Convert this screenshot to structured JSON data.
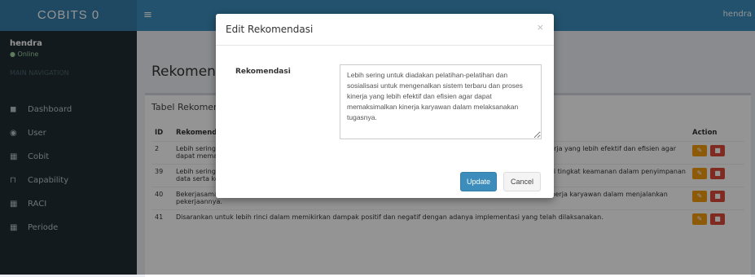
{
  "app": {
    "logo": "COBITS 0",
    "hamburger_icon": "hamburger-icon",
    "topbar_user": "hendra"
  },
  "sidebar": {
    "user_name": "hendra",
    "user_status": "● Online",
    "header": "MAIN NAVIGATION",
    "items": [
      {
        "icon": "dashboard-icon",
        "glyph": "◼",
        "label": "Dashboard"
      },
      {
        "icon": "user-icon",
        "glyph": "◉",
        "label": "User"
      },
      {
        "icon": "cobit-icon",
        "glyph": "▦",
        "label": "Cobit"
      },
      {
        "icon": "capability-icon",
        "glyph": "⊓",
        "label": "Capability"
      },
      {
        "icon": "raci-icon",
        "glyph": "▦",
        "label": "RACI"
      },
      {
        "icon": "periode-icon",
        "glyph": "▦",
        "label": "Periode"
      }
    ]
  },
  "page": {
    "title": "Rekomendasi",
    "box_title": "Tabel Rekomendasi",
    "columns": {
      "id": "ID",
      "rekomendasi": "Rekomendasi",
      "action": "Action"
    },
    "rows": [
      {
        "id": "2",
        "text": "Lebih sering untuk diadakan pelatihan-pelatihan dan sosialisasi untuk mengenalkan sistem terbaru dan proses kinerja yang lebih efektif dan efisien agar dapat memaksimalkan kinerja karyawan dalam melaksanakan tugasnya."
      },
      {
        "id": "39",
        "text": "Lebih sering dilakukan pengecekan terhadap sistem untuk mengurangi resiko terjadinya kesalahan dan mengetahui tingkat keamanan dalam penyimpanan data serta kemungkinan terjadinya tingkat kehilangan data."
      },
      {
        "id": "40",
        "text": "Bekerjasama dan saling mendukung serta cepat beradaptasi ketika terdapat sistem baru untuk memaksimalkan kinerja karyawan dalam menjalankan pekerjaannya."
      },
      {
        "id": "41",
        "text": "Disarankan untuk lebih rinci dalam memikirkan dampak positif dan negatif dengan adanya implementasi yang telah dilaksanakan."
      }
    ],
    "edit_icon": "edit-icon",
    "delete_icon": "trash-icon"
  },
  "modal": {
    "title": "Edit Rekomendasi",
    "close_icon": "close-icon",
    "label": "Rekomendasi",
    "value": "Lebih sering untuk diadakan pelatihan-pelatihan dan sosialisasi untuk mengenalkan sistem terbaru dan proses kinerja yang lebih efektif dan efisien agar dapat memaksimalkan kinerja karyawan dalam melaksanakan tugasnya.",
    "update_label": "Update",
    "cancel_label": "Cancel"
  },
  "colors": {
    "topbar": "#3c8dbc",
    "sidebar": "#222d32",
    "primary": "#3c8dbc",
    "warning": "#f39c12",
    "danger": "#dd4b39"
  }
}
